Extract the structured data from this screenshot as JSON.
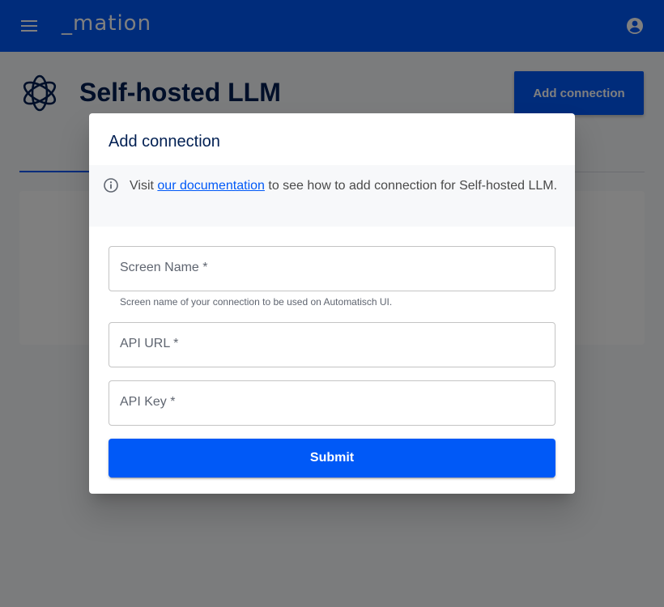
{
  "appbar": {
    "logo_text": "_mation",
    "menu_icon": "menu-icon",
    "account_icon": "account-circle-icon",
    "color": "#0059f7"
  },
  "page": {
    "title": "Self-hosted LLM",
    "app_icon": "openai-logo-icon",
    "add_connection_label": "Add connection"
  },
  "dialog": {
    "title": "Add connection",
    "info": {
      "icon": "info-icon",
      "prefix": "Visit ",
      "link_text": "our documentation",
      "suffix": " to see how to add connection for Self-hosted LLM."
    },
    "fields": {
      "screen_name": {
        "label": "Screen Name *",
        "value": "",
        "helper": "Screen name of your connection to be used on Automatisch UI."
      },
      "api_url": {
        "label": "API URL *",
        "value": ""
      },
      "api_key": {
        "label": "API Key *",
        "value": ""
      }
    },
    "submit_label": "Submit"
  }
}
